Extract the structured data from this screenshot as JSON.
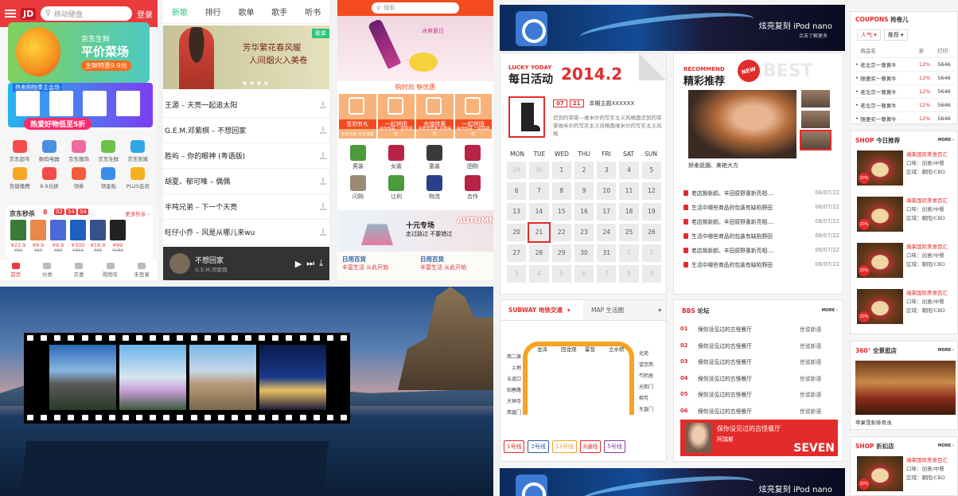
{
  "jd": {
    "logo": "JD",
    "search_placeholder": "移动硬盘",
    "login": "登录",
    "banner": {
      "line1": "京东生鲜",
      "line2": "平价菜场",
      "line3": "生鲜特惠9.9元"
    },
    "promo": {
      "title": "热卖购物季主会场",
      "bar": "热爱好物低至5折"
    },
    "grid": [
      {
        "label": "京东超市",
        "color": "#f44c4c"
      },
      {
        "label": "数码电器",
        "color": "#4a90e2"
      },
      {
        "label": "京东服饰",
        "color": "#f06aa0"
      },
      {
        "label": "京东生鲜",
        "color": "#6cc24a"
      },
      {
        "label": "京东到家",
        "color": "#2fa8e6"
      },
      {
        "label": "充值缴费",
        "color": "#f5a623"
      },
      {
        "label": "9.9元拼",
        "color": "#f44c4c"
      },
      {
        "label": "领券",
        "color": "#f25d3c"
      },
      {
        "label": "领金贴",
        "color": "#3a8ee6"
      },
      {
        "label": "PLUS会员",
        "color": "#f5b21d"
      }
    ],
    "seckill": {
      "title": "京东秒杀",
      "hour": "8",
      "time": [
        "02",
        "54",
        "54"
      ],
      "more": "更多秒杀 ›",
      "items": [
        {
          "price": "¥22.9",
          "old": "¥99",
          "color": "#3b7a3b"
        },
        {
          "price": "¥9.9",
          "old": "¥69",
          "color": "#e8884a"
        },
        {
          "price": "¥9.9",
          "old": "¥89",
          "color": "#4a6ad8"
        },
        {
          "price": "¥300",
          "old": "¥359",
          "color": "#1f5fbf"
        },
        {
          "price": "¥19.9",
          "old": "¥39",
          "color": "#37528a"
        },
        {
          "price": "¥99",
          "old": "¥189",
          "color": "#222"
        }
      ]
    },
    "tabbar": [
      "首页",
      "分类",
      "京喜",
      "购物车",
      "未登录"
    ]
  },
  "music": {
    "tabs": [
      "新歌",
      "排行",
      "歌单",
      "歌手",
      "听书"
    ],
    "banner": {
      "line1": "芳华繁花春风暖",
      "line2": "人间烟火入美卷",
      "badge": "歌单"
    },
    "songs": [
      "王源 – 天亮一起追太阳",
      "G.E.M.邓紫棋 – 不想回家",
      "胜屿 – 你的眼神 (粤语版)",
      "胡夏、郁可唯 – 偶偶",
      "半吨兄弟 – 下一个天亮",
      "旺仔小乔 – 风是从哪儿来wu"
    ],
    "player": {
      "title": "不想回家",
      "artist": "G.E.M.邓紫棋",
      "play": "▶",
      "next": "⏭",
      "dl": "⤓"
    }
  },
  "shop": {
    "search_placeholder": "搜索",
    "hero_text": "冰爽夏日",
    "headline": "购时尚 够优惠",
    "cats": [
      {
        "label": "签到有礼",
        "sub": "全年无休 天天惊喜"
      },
      {
        "label": "一起拼团",
        "sub": "给你惊喜 一起拼团 优"
      },
      {
        "label": "充值特惠",
        "sub": "充值享优惠 充值得 优"
      },
      {
        "label": "一起拼团",
        "sub": "给你惊喜 一起拼团 优"
      }
    ],
    "icons": [
      {
        "label": "男装",
        "color": "#4c9b3b"
      },
      {
        "label": "女装",
        "color": "#b92345"
      },
      {
        "label": "童装",
        "color": "#3a3a3a"
      },
      {
        "label": "团购",
        "color": "#b92345"
      },
      {
        "label": "闪购",
        "color": "#9a8a76"
      },
      {
        "label": "让利",
        "color": "#4c9b3b"
      },
      {
        "label": "物流",
        "color": "#2a3f8a"
      },
      {
        "label": "合作",
        "color": "#b92345"
      }
    ],
    "fashion": {
      "line1": "十元专场",
      "line2": "走过路过 不要错过",
      "tag": "AUTUMN"
    },
    "tiles": [
      {
        "title": "日用百货",
        "sub": "丰富生活 从此开始"
      },
      {
        "title": "日用百货",
        "sub": "丰富生活 从此开始"
      }
    ]
  },
  "portal": {
    "ipod": {
      "title": "炫亮复刻  iPod nano",
      "sub": "点击了解更多"
    },
    "activity": {
      "en": "LUCKY YODAY",
      "title": "每日活动",
      "year": "2014.2",
      "month": "07",
      "day": "21",
      "theme": "本期主题XXXXXX",
      "desc": "迟到的荣誉—维米尔的写实主义风格面迟到的荣誉维米尔的写实主义风格面维米尔的写实主义风格",
      "weekdays": [
        "MON",
        "TUE",
        "WED",
        "THU",
        "FRI",
        "SAT",
        "SUN"
      ],
      "days": [
        {
          "d": "29",
          "dim": true
        },
        {
          "d": "30",
          "dim": true
        },
        {
          "d": "1"
        },
        {
          "d": "2"
        },
        {
          "d": "3"
        },
        {
          "d": "4"
        },
        {
          "d": "5"
        },
        {
          "d": "6"
        },
        {
          "d": "7"
        },
        {
          "d": "8"
        },
        {
          "d": "9"
        },
        {
          "d": "10"
        },
        {
          "d": "11"
        },
        {
          "d": "12"
        },
        {
          "d": "13"
        },
        {
          "d": "14"
        },
        {
          "d": "15"
        },
        {
          "d": "16"
        },
        {
          "d": "17"
        },
        {
          "d": "18"
        },
        {
          "d": "19"
        },
        {
          "d": "20"
        },
        {
          "d": "21",
          "hl": true
        },
        {
          "d": "22"
        },
        {
          "d": "23"
        },
        {
          "d": "24"
        },
        {
          "d": "25"
        },
        {
          "d": "26"
        },
        {
          "d": "27"
        },
        {
          "d": "28"
        },
        {
          "d": "29"
        },
        {
          "d": "30"
        },
        {
          "d": "31"
        },
        {
          "d": "1",
          "dim": true
        },
        {
          "d": "2",
          "dim": true
        },
        {
          "d": "3",
          "dim": true
        },
        {
          "d": "4",
          "dim": true
        },
        {
          "d": "5",
          "dim": true
        },
        {
          "d": "6",
          "dim": true
        },
        {
          "d": "7",
          "dim": true
        },
        {
          "d": "8",
          "dim": true
        },
        {
          "d": "9",
          "dim": true
        }
      ]
    },
    "recommend": {
      "en": "RECOMMEND",
      "title": "精彩推荐",
      "new": "NEW",
      "best": "BEST",
      "caption": "娇柔妩媚、美艳大方",
      "news": [
        {
          "t": "老店换新颜。丰田原野重新亮相....",
          "d": "08/07/22"
        },
        {
          "t": "生活中哪些商品的包装有缺陷野田",
          "d": "08/07/22"
        },
        {
          "t": "老店换新颜。丰田原野重新亮相....",
          "d": "08/07/22"
        },
        {
          "t": "生活中哪些商品的包装有缺陷野田",
          "d": "08/07/22"
        },
        {
          "t": "老店换新颜。丰田原野重新亮相....",
          "d": "08/07/22"
        },
        {
          "t": "生活中哪些商品的包装有缺陷野田",
          "d": "08/07/22"
        }
      ]
    },
    "subway": {
      "tab1": "SUBWAY 地铁交通",
      "tab2": "MAP 生活圈",
      "stations_top": [
        "龙泽",
        "回龙观",
        "霍营",
        "立水桥"
      ],
      "stations_left": [
        "西二旗",
        "上地",
        "五道口",
        "知春路",
        "大钟寺",
        "西直门"
      ],
      "stations_right": [
        "北苑",
        "望京西",
        "芍药居",
        "光熙门",
        "柳芳",
        "东直门"
      ],
      "lines": [
        {
          "label": "1号线",
          "color": "#e42b2b"
        },
        {
          "label": "2号线",
          "color": "#2a5ea8"
        },
        {
          "label": "13号线",
          "color": "#f6a323"
        },
        {
          "label": "8通线",
          "color": "#e42b2b"
        },
        {
          "label": "5号线",
          "color": "#8a3a9a"
        }
      ]
    },
    "bbs": {
      "en": "BBS",
      "title": "论坛",
      "more": "MORE ›",
      "rows": [
        {
          "n": "01",
          "t": "保你没见过的古怪餐厅",
          "u": "世说新语"
        },
        {
          "n": "02",
          "t": "保你没见过的古怪餐厅",
          "u": "世说新语"
        },
        {
          "n": "03",
          "t": "保你没见过的古怪餐厅",
          "u": "世说新语"
        },
        {
          "n": "04",
          "t": "保你没见过的古怪餐厅",
          "u": "世说新语"
        },
        {
          "n": "05",
          "t": "保你没见过的古怪餐厅",
          "u": "世说新语"
        },
        {
          "n": "06",
          "t": "保你没见过的古怪餐厅",
          "u": "世说新语"
        }
      ],
      "banner": {
        "t": "保你没见过的古怪餐厅",
        "u": "阿瑞斯",
        "big": "SEVEN"
      }
    }
  },
  "right": {
    "coupons": {
      "en": "COUPONS",
      "title": "抢卷儿",
      "filters": [
        "人气 ▾",
        "推荐 ▾"
      ],
      "headers": [
        "",
        "商品名",
        "折",
        "打印"
      ],
      "rows": [
        {
          "name": "老北京一尊黄牛",
          "pct": "12%",
          "v": "5646"
        },
        {
          "name": "随便买一尊黄牛",
          "pct": "12%",
          "v": "5646"
        },
        {
          "name": "老北京一尊黄牛",
          "pct": "12%",
          "v": "5646"
        },
        {
          "name": "老北京一尊黄牛",
          "pct": "12%",
          "v": "5646"
        },
        {
          "name": "随便买一尊黄牛",
          "pct": "12%",
          "v": "5646"
        }
      ]
    },
    "today": {
      "en": "SHOP",
      "title": "今日推荐",
      "more": "MORE ›",
      "items": [
        {
          "name": "瀚莱国际美食百汇",
          "type": "口味：创意/中餐",
          "area": "区域：朝阳/CBD",
          "off": "20%"
        },
        {
          "name": "瀚莱国际美食百汇",
          "type": "口味：创意/中餐",
          "area": "区域：朝阳/CBD",
          "off": "20%"
        },
        {
          "name": "瀚莱国际美食百汇",
          "type": "口味：创意/中餐",
          "area": "区域：朝阳/CBD",
          "off": "20%"
        },
        {
          "name": "瀚莱国际美食百汇",
          "type": "口味：创意/中餐",
          "area": "区域：朝阳/CBD",
          "off": "20%"
        }
      ]
    },
    "pano": {
      "en": "360°",
      "title": "全景逛店",
      "more": "MORE ›",
      "caption": "苹果雪梨排骨汤"
    },
    "discount": {
      "en": "SHOP",
      "title": "折扣店",
      "more": "MORE ›",
      "item": {
        "name": "瀚莱国际美食百汇",
        "type": "口味：创意/中餐",
        "area": "区域：朝阳/CBD",
        "off": "20%"
      }
    }
  }
}
